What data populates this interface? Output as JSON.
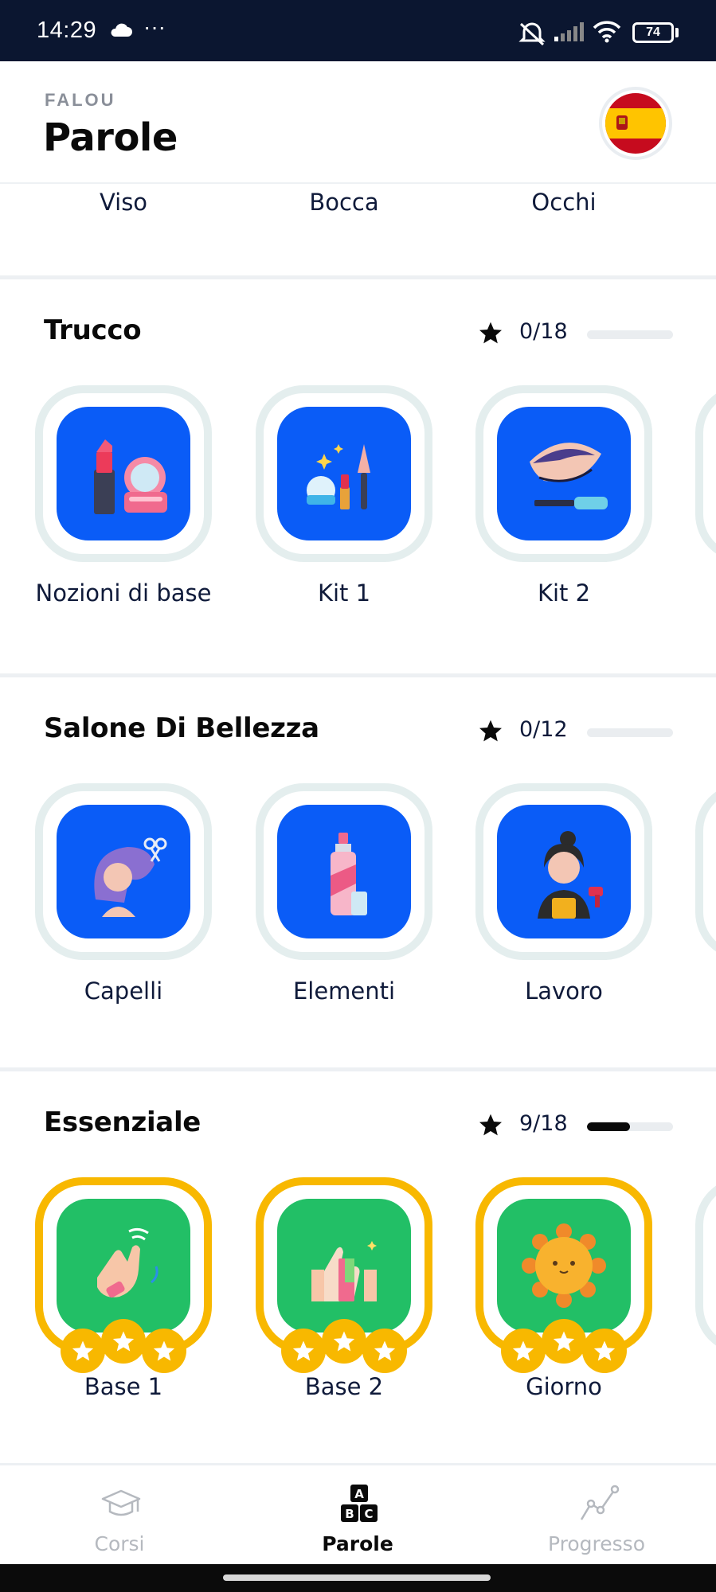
{
  "status_bar": {
    "time": "14:29",
    "more": "···",
    "battery": "74"
  },
  "header": {
    "brand": "FALOU",
    "title": "Parole",
    "language_flag": "spain-flag"
  },
  "previous_section": {
    "items": [
      "Viso",
      "Bocca",
      "Occhi"
    ]
  },
  "sections": [
    {
      "title": "Trucco",
      "progress_text": "0/18",
      "progress_fraction": 0,
      "items": [
        {
          "label": "Nozioni di base",
          "icon": "lipstick-compact-icon",
          "stars": 0
        },
        {
          "label": "Kit 1",
          "icon": "makeup-kit-icon",
          "stars": 0
        },
        {
          "label": "Kit 2",
          "icon": "eye-mascara-icon",
          "stars": 0
        }
      ]
    },
    {
      "title": "Salone Di Bellezza",
      "progress_text": "0/12",
      "progress_fraction": 0,
      "items": [
        {
          "label": "Capelli",
          "icon": "haircut-icon",
          "stars": 0
        },
        {
          "label": "Elementi",
          "icon": "spray-bottle-icon",
          "stars": 0
        },
        {
          "label": "Lavoro",
          "icon": "hairdresser-icon",
          "stars": 0
        }
      ]
    },
    {
      "title": "Essenziale",
      "progress_text": "9/18",
      "progress_fraction": 0.5,
      "items": [
        {
          "label": "Base 1",
          "icon": "waving-hand-icon",
          "stars": 3
        },
        {
          "label": "Base 2",
          "icon": "thumbs-up-icon",
          "stars": 3
        },
        {
          "label": "Giorno",
          "icon": "sun-icon",
          "stars": 3
        }
      ]
    }
  ],
  "bottom_nav": [
    {
      "label": "Corsi",
      "icon": "graduation-cap-icon",
      "active": false
    },
    {
      "label": "Parole",
      "icon": "abc-blocks-icon",
      "active": true
    },
    {
      "label": "Progresso",
      "icon": "progress-chart-icon",
      "active": false
    }
  ],
  "colors": {
    "tile_blue": "#0a5cf7",
    "tile_green": "#22bf66",
    "gold": "#f8b800",
    "status_bar": "#0b1630"
  }
}
